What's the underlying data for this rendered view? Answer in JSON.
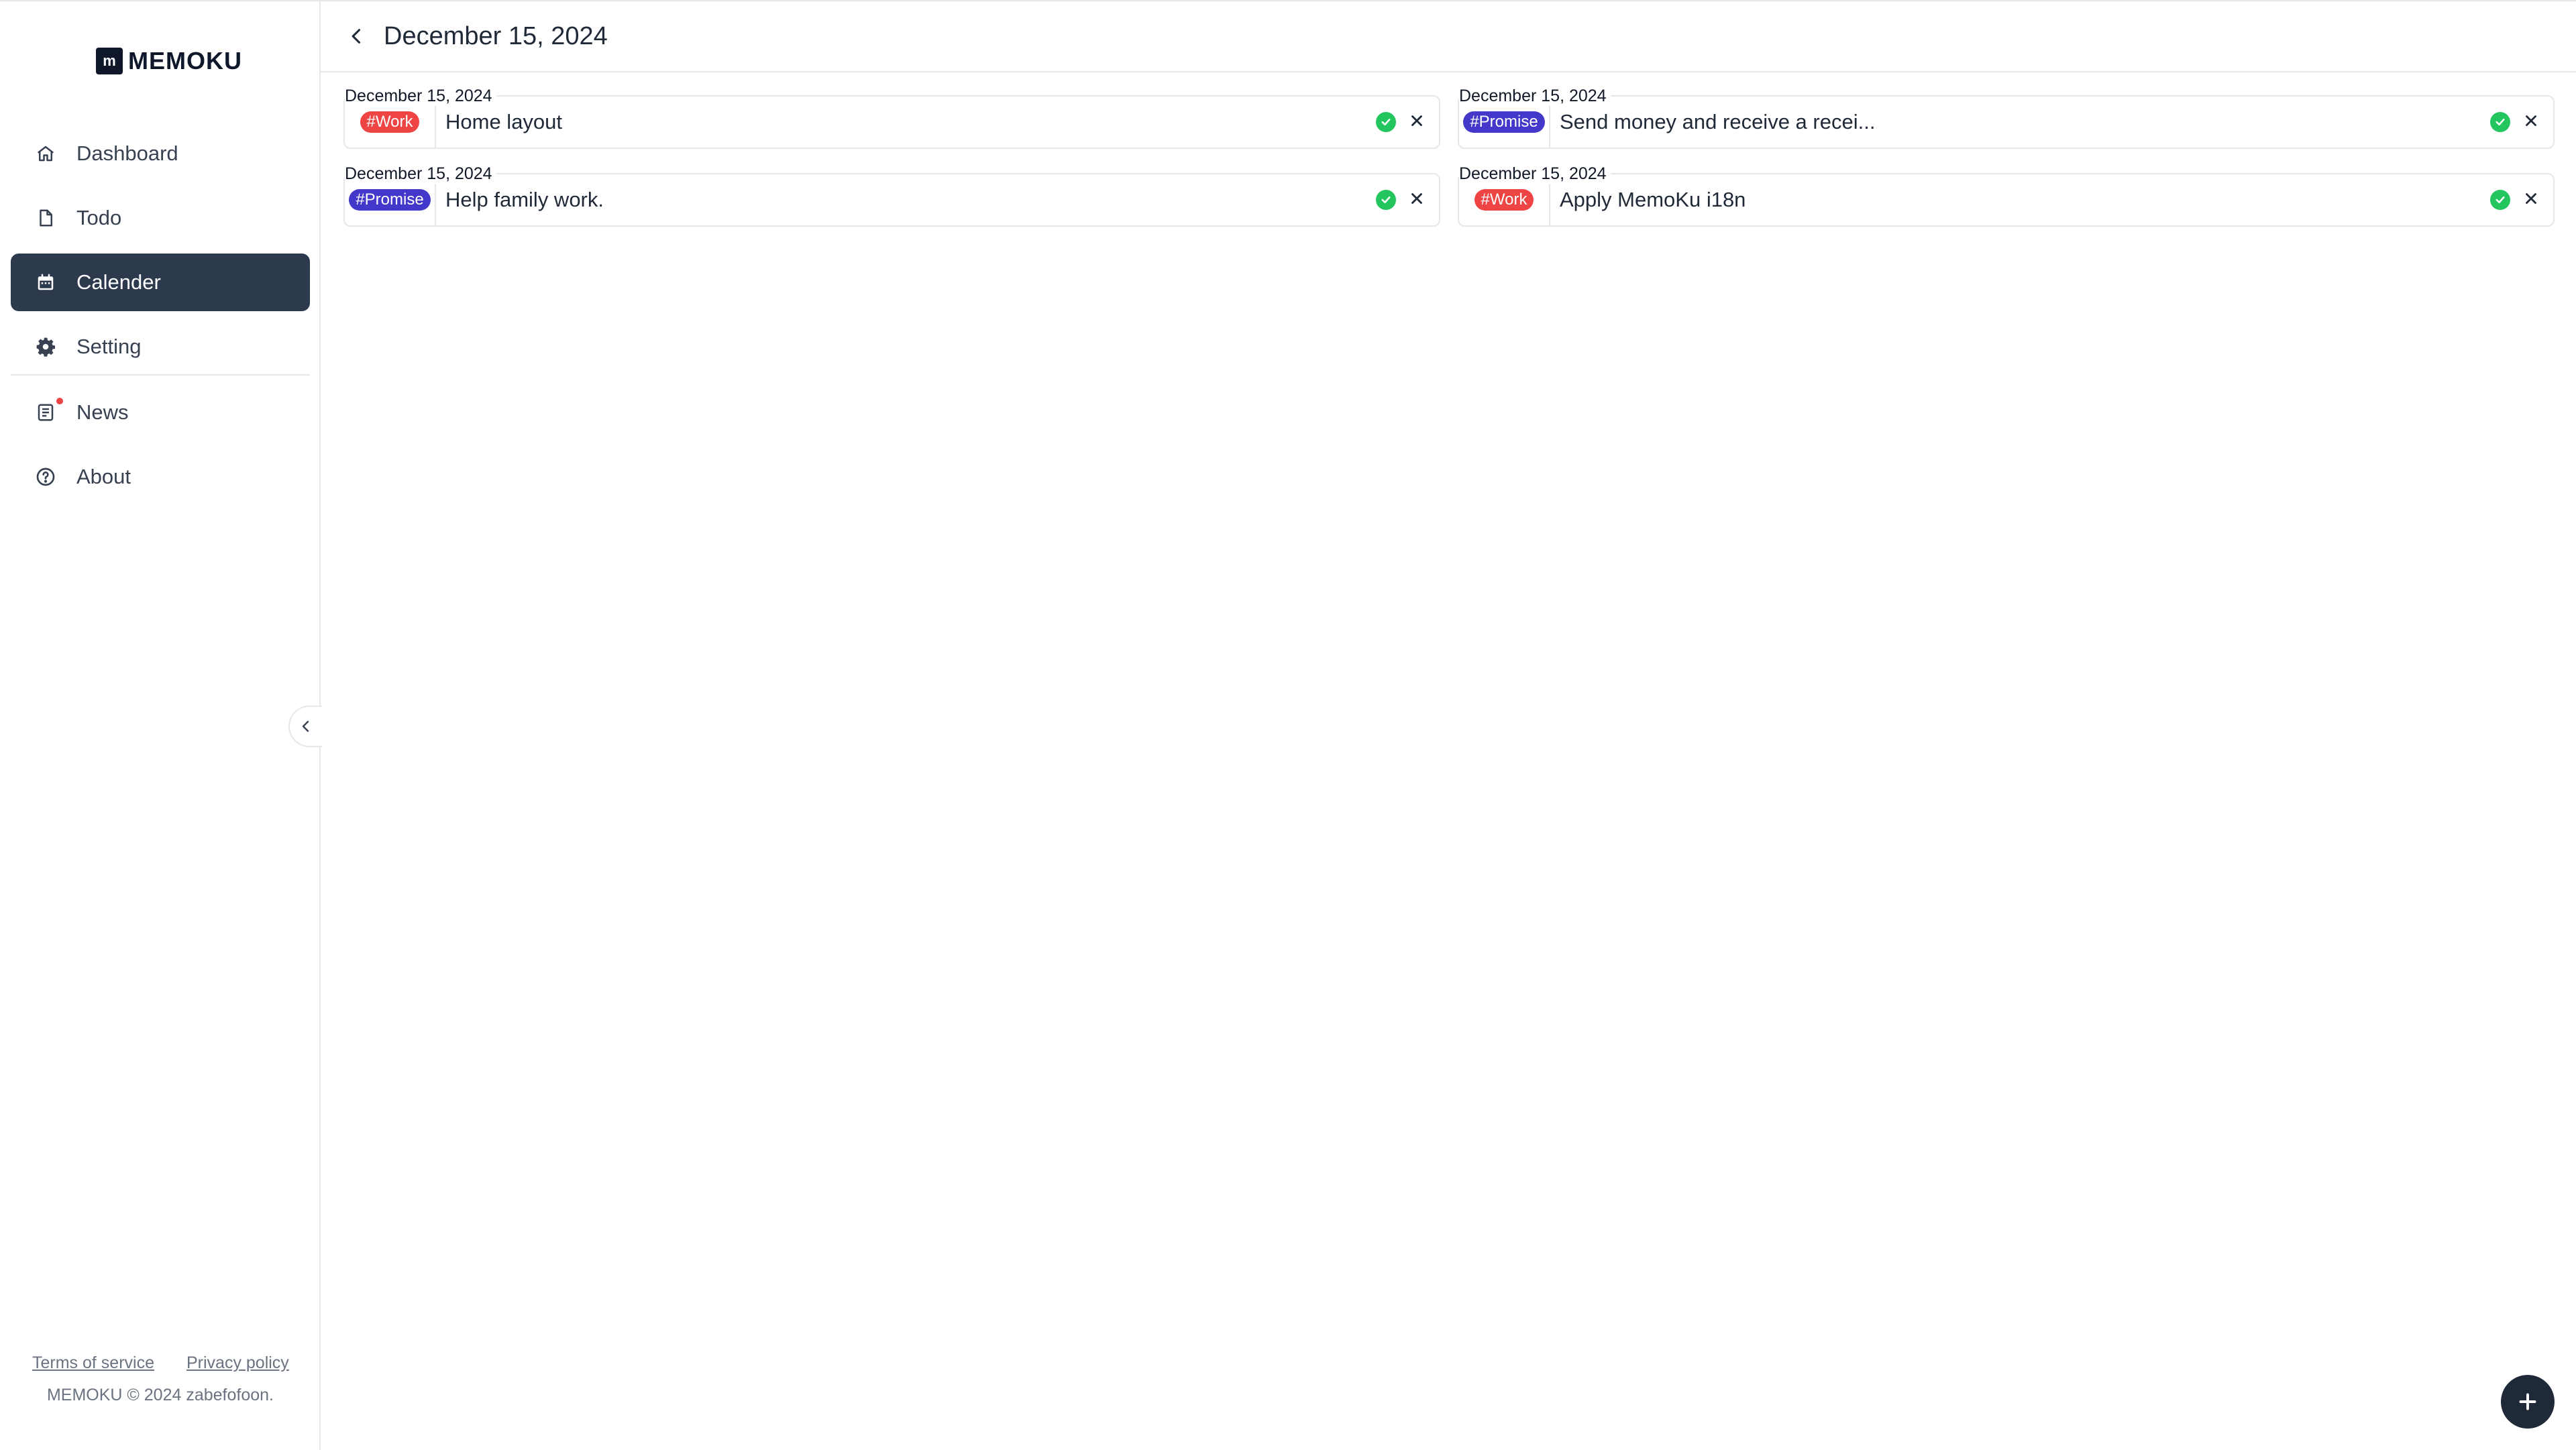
{
  "app": {
    "name": "MEMOKU",
    "logo_letter": "m"
  },
  "sidebar": {
    "items": [
      {
        "label": "Dashboard",
        "icon": "home-icon"
      },
      {
        "label": "Todo",
        "icon": "file-icon"
      },
      {
        "label": "Calender",
        "icon": "calendar-icon",
        "active": true
      },
      {
        "label": "Setting",
        "icon": "gear-icon"
      },
      {
        "label": "News",
        "icon": "news-icon",
        "badge": "unread-dot"
      },
      {
        "label": "About",
        "icon": "help-circle-icon"
      }
    ],
    "footer": {
      "terms": "Terms of service",
      "privacy": "Privacy policy",
      "copyright": "MEMOKU © 2024 zabefofoon."
    }
  },
  "header": {
    "title": "December 15, 2024"
  },
  "entries": [
    {
      "date": "December 15, 2024",
      "tag": "#Work",
      "tag_color": "#ef4444",
      "text": "Home layout"
    },
    {
      "date": "December 15, 2024",
      "tag": "#Promise",
      "tag_color": "#4338ca",
      "text": "Send money and receive a recei..."
    },
    {
      "date": "December 15, 2024",
      "tag": "#Promise",
      "tag_color": "#4338ca",
      "text": "Help family work."
    },
    {
      "date": "December 15, 2024",
      "tag": "#Work",
      "tag_color": "#ef4444",
      "text": "Apply MemoKu i18n"
    }
  ],
  "colors": {
    "sidebar_active": "#2d3a4e",
    "done": "#22c55e",
    "fab": "#1f2937"
  }
}
